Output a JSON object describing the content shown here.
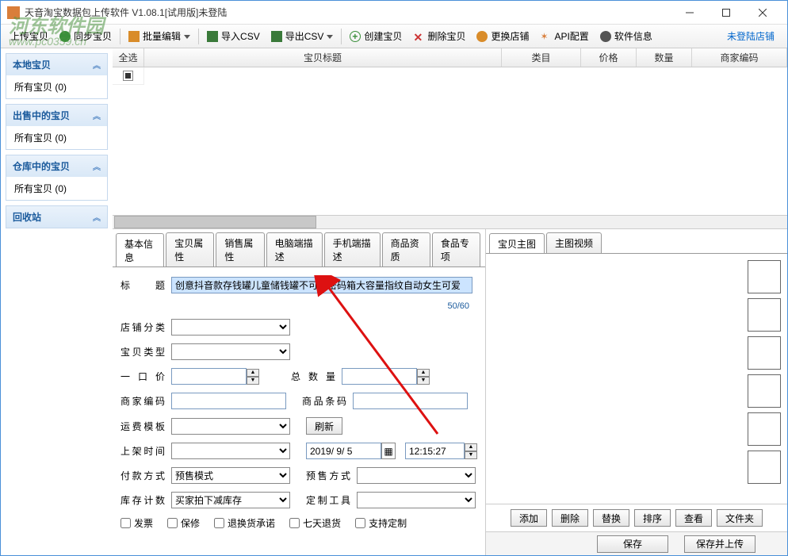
{
  "window": {
    "title": "天音淘宝数据包上传软件 V1.08.1[试用版]未登陆"
  },
  "toolbar": {
    "upload": "上传宝贝",
    "sync": "同步宝贝",
    "batch_edit": "批量编辑",
    "import_csv": "导入CSV",
    "export_csv": "导出CSV",
    "create": "创建宝贝",
    "delete": "删除宝贝",
    "change_shop": "更换店铺",
    "api": "API配置",
    "info": "软件信息",
    "login_link": "未登陆店铺"
  },
  "sidebar": {
    "groups": [
      {
        "title": "本地宝贝",
        "item": "所有宝贝 (0)"
      },
      {
        "title": "出售中的宝贝",
        "item": "所有宝贝 (0)"
      },
      {
        "title": "仓库中的宝贝",
        "item": "所有宝贝 (0)"
      },
      {
        "title": "回收站",
        "item": ""
      }
    ]
  },
  "grid": {
    "headers": {
      "select": "全选",
      "title": "宝贝标题",
      "category": "类目",
      "price": "价格",
      "qty": "数量",
      "code": "商家编码"
    }
  },
  "tabs": [
    "基本信息",
    "宝贝属性",
    "销售属性",
    "电脑端描述",
    "手机端描述",
    "商品资质",
    "食品专项"
  ],
  "form": {
    "title_label": "标题",
    "title_value": "创意抖音款存钱罐儿童储钱罐不可取密码箱大容量指纹自动女生可爱",
    "title_counter": "50/60",
    "shop_cat": "店铺分类",
    "item_type": "宝贝类型",
    "price": "一 口 价",
    "total_qty": "总 数 量",
    "seller_code": "商家编码",
    "barcode": "商品条码",
    "ship_tpl": "运费模板",
    "refresh": "刷新",
    "list_time": "上架时间",
    "date_value": "2019/ 9/ 5",
    "time_value": "12:15:27",
    "pay_method": "付款方式",
    "pay_method_val": "预售模式",
    "presale_method": "预售方式",
    "stock_calc": "库存计数",
    "stock_calc_val": "买家拍下减库存",
    "custom_tool": "定制工具",
    "invoice": "发票",
    "warranty": "保修",
    "return_promise": "退换货承诺",
    "seven_day": "七天退货",
    "support_custom": "支持定制"
  },
  "image_tabs": [
    "宝贝主图",
    "主图视频"
  ],
  "image_buttons": [
    "添加",
    "删除",
    "替换",
    "排序",
    "查看",
    "文件夹"
  ],
  "footer": {
    "save": "保存",
    "save_upload": "保存并上传"
  },
  "watermark": {
    "line1": "河东软件园",
    "line2": "www.pc0359.cn"
  }
}
